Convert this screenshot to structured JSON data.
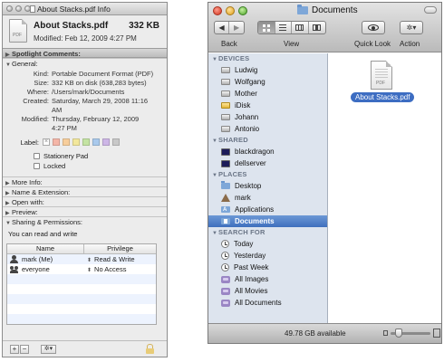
{
  "info": {
    "title": "About Stacks.pdf Info",
    "file_name": "About Stacks.pdf",
    "file_size": "332 KB",
    "modified_line": "Modified: Feb 12, 2009 4:27 PM",
    "file_tag": "PDF",
    "spotlight_label": "Spotlight Comments:",
    "general_label": "General:",
    "general_rows": [
      {
        "k": "Kind:",
        "v": "Portable Document Format (PDF)"
      },
      {
        "k": "Size:",
        "v": "332 KB on disk (638,283 bytes)"
      },
      {
        "k": "Where:",
        "v": "/Users/mark/Documents"
      },
      {
        "k": "Created:",
        "v": "Saturday, March 29, 2008 11:16"
      },
      {
        "k": "",
        "v": "AM"
      },
      {
        "k": "Modified:",
        "v": "Thursday, February 12, 2009"
      },
      {
        "k": "",
        "v": "4:27 PM"
      }
    ],
    "label_label": "Label:",
    "label_none_glyph": "×",
    "label_colors": [
      "#f4b6a8",
      "#f7ce9c",
      "#f2e79c",
      "#c4e3a3",
      "#a9c9ec",
      "#cdb6e6",
      "#c8c8c8"
    ],
    "stationery_label": "Stationery Pad",
    "locked_label": "Locked",
    "more_info_label": "More Info:",
    "name_ext_label": "Name & Extension:",
    "open_with_label": "Open with:",
    "preview_label": "Preview:",
    "sharing_label": "Sharing & Permissions:",
    "sharing_status": "You can read and write",
    "table_headers": {
      "name": "Name",
      "privilege": "Privilege"
    },
    "permissions": [
      {
        "name": "mark (Me)",
        "privilege": "Read & Write",
        "icon": "user-icon"
      },
      {
        "name": "everyone",
        "privilege": "No Access",
        "icon": "group-icon"
      }
    ],
    "footer_plus": "+",
    "footer_minus": "−",
    "footer_gear": "✲▾"
  },
  "finder": {
    "title": "Documents",
    "back_label": "Back",
    "view_label": "View",
    "quicklook_label": "Quick Look",
    "action_label": "Action",
    "back_glyph": "◀",
    "forward_glyph": "▶",
    "action_glyph": "✲▾",
    "sidebar": [
      {
        "heading": "DEVICES",
        "items": [
          {
            "label": "Ludwig",
            "icon": "hdd-icon"
          },
          {
            "label": "Wolfgang",
            "icon": "hdd-icon"
          },
          {
            "label": "Mother",
            "icon": "hdd-icon"
          },
          {
            "label": "iDisk",
            "icon": "idisk-icon"
          },
          {
            "label": "Johann",
            "icon": "hdd-icon"
          },
          {
            "label": "Antonio",
            "icon": "hdd-icon"
          }
        ]
      },
      {
        "heading": "SHARED",
        "items": [
          {
            "label": "blackdragon",
            "icon": "screen-icon"
          },
          {
            "label": "dellserver",
            "icon": "screen-icon"
          }
        ]
      },
      {
        "heading": "PLACES",
        "items": [
          {
            "label": "Desktop",
            "icon": "folder-icon"
          },
          {
            "label": "mark",
            "icon": "home-icon"
          },
          {
            "label": "Applications",
            "icon": "apps-icon"
          },
          {
            "label": "Documents",
            "icon": "docs-icon",
            "selected": true
          }
        ]
      },
      {
        "heading": "SEARCH FOR",
        "items": [
          {
            "label": "Today",
            "icon": "clock-icon"
          },
          {
            "label": "Yesterday",
            "icon": "clock-icon"
          },
          {
            "label": "Past Week",
            "icon": "clock-icon"
          },
          {
            "label": "All Images",
            "icon": "smart-folder-icon"
          },
          {
            "label": "All Movies",
            "icon": "smart-folder-icon"
          },
          {
            "label": "All Documents",
            "icon": "smart-folder-icon"
          }
        ]
      }
    ],
    "file_label": "About Stacks.pdf",
    "file_tag": "PDF",
    "status_text": "49.78 GB available",
    "selection_color": "#3d6dc2",
    "sidebar_bg": "#dde4ee"
  }
}
